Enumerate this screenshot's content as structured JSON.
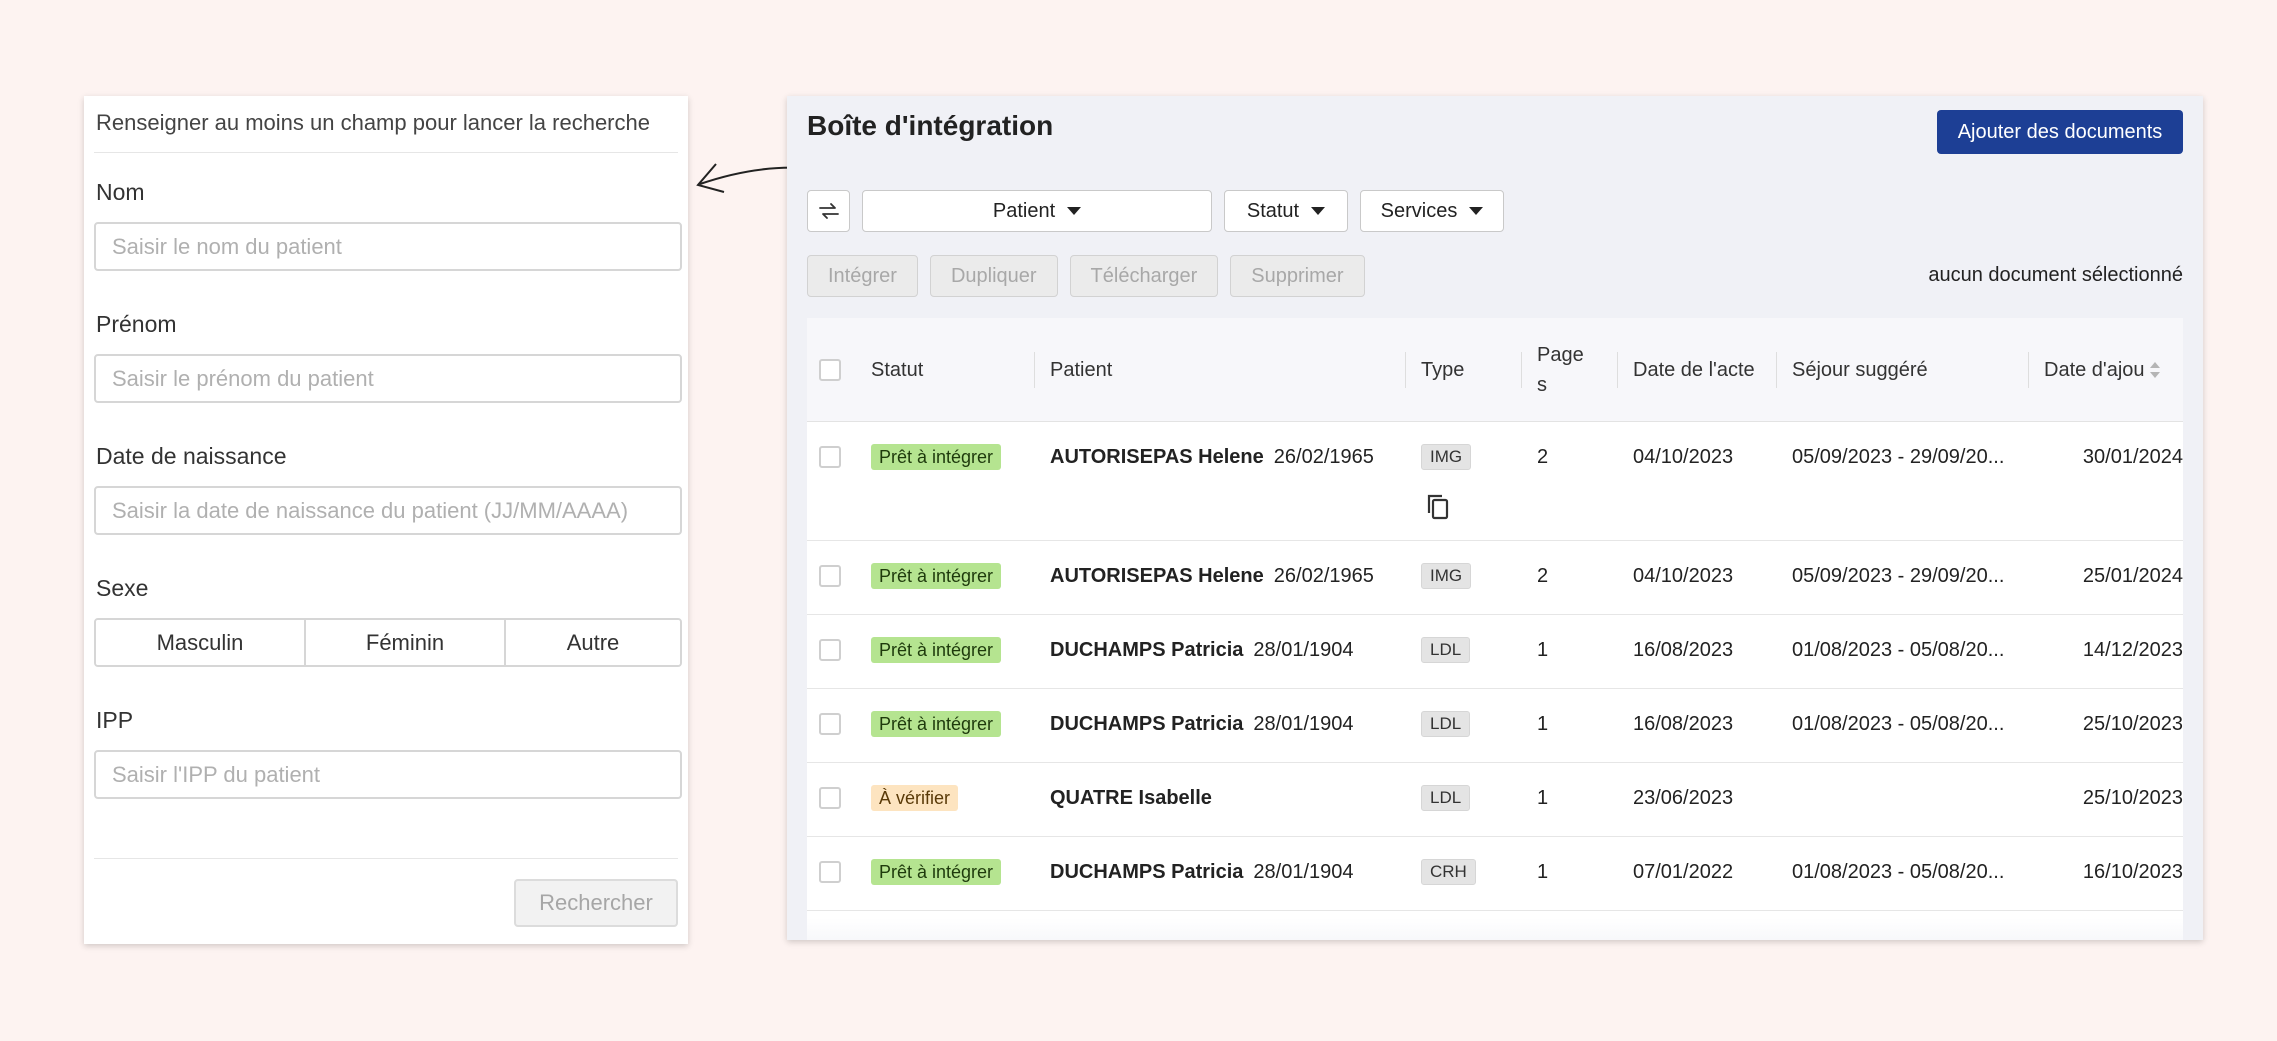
{
  "search": {
    "hint": "Renseigner au moins un champ pour lancer la recherche",
    "nom_label": "Nom",
    "nom_placeholder": "Saisir le nom du patient",
    "prenom_label": "Prénom",
    "prenom_placeholder": "Saisir le prénom du patient",
    "dob_label": "Date de naissance",
    "dob_placeholder": "Saisir la date de naissance du patient (JJ/MM/AAAA)",
    "sexe_label": "Sexe",
    "sexe_options": [
      "Masculin",
      "Féminin",
      "Autre"
    ],
    "ipp_label": "IPP",
    "ipp_placeholder": "Saisir l'IPP du patient",
    "search_button": "Rechercher"
  },
  "inbox": {
    "title": "Boîte d'intégration",
    "add_button": "Ajouter des documents",
    "filters": {
      "patient": "Patient",
      "statut": "Statut",
      "services": "Services"
    },
    "actions": [
      "Intégrer",
      "Dupliquer",
      "Télécharger",
      "Supprimer"
    ],
    "selection_status": "aucun document sélectionné",
    "columns": {
      "statut": "Statut",
      "patient": "Patient",
      "type": "Type",
      "pages_1": "Page",
      "pages_2": "s",
      "date_acte": "Date de l'acte",
      "sejour": "Séjour suggéré",
      "date_ajout": "Date d'ajou"
    },
    "rows": [
      {
        "status": "Prêt à intégrer",
        "status_kind": "ready",
        "name": "AUTORISEPAS Helene",
        "dob": "26/02/1965",
        "type": "IMG",
        "pages": "2",
        "date_acte": "04/10/2023",
        "sejour": "05/09/2023 - 29/09/20...",
        "date_ajout": "30/01/2024"
      },
      {
        "status": "Prêt à intégrer",
        "status_kind": "ready",
        "name": "AUTORISEPAS Helene",
        "dob": "26/02/1965",
        "type": "IMG",
        "pages": "2",
        "date_acte": "04/10/2023",
        "sejour": "05/09/2023 - 29/09/20...",
        "date_ajout": "25/01/2024"
      },
      {
        "status": "Prêt à intégrer",
        "status_kind": "ready",
        "name": "DUCHAMPS Patricia",
        "dob": "28/01/1904",
        "type": "LDL",
        "pages": "1",
        "date_acte": "16/08/2023",
        "sejour": "01/08/2023 - 05/08/20...",
        "date_ajout": "14/12/2023"
      },
      {
        "status": "Prêt à intégrer",
        "status_kind": "ready",
        "name": "DUCHAMPS Patricia",
        "dob": "28/01/1904",
        "type": "LDL",
        "pages": "1",
        "date_acte": "16/08/2023",
        "sejour": "01/08/2023 - 05/08/20...",
        "date_ajout": "25/10/2023"
      },
      {
        "status": "À vérifier",
        "status_kind": "check",
        "name": "QUATRE Isabelle",
        "dob": "",
        "type": "LDL",
        "pages": "1",
        "date_acte": "23/06/2023",
        "sejour": "",
        "date_ajout": "25/10/2023"
      },
      {
        "status": "Prêt à intégrer",
        "status_kind": "ready",
        "name": "DUCHAMPS Patricia",
        "dob": "28/01/1904",
        "type": "CRH",
        "pages": "1",
        "date_acte": "07/01/2022",
        "sejour": "01/08/2023 - 05/08/20...",
        "date_ajout": "16/10/2023"
      }
    ]
  },
  "colors": {
    "primary": "#1d3f95",
    "ready_badge": "#b5e490",
    "check_badge": "#fde4c0",
    "background": "#fdf3f1"
  },
  "icons": {
    "refresh": "refresh-icon",
    "copy": "copy-icon",
    "caret": "chevron-down-icon",
    "sort": "sort-icon",
    "arrow": "arrow-icon"
  }
}
